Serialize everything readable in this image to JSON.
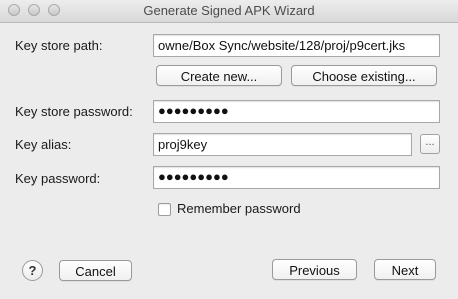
{
  "window": {
    "title": "Generate Signed APK Wizard"
  },
  "fields": {
    "key_store_path_label": "Key store path:",
    "key_store_path_value": "owne/Box Sync/website/128/proj/p9cert.jks",
    "key_store_password_label": "Key store password:",
    "key_store_password_value": "●●●●●●●●●",
    "key_alias_label": "Key alias:",
    "key_alias_value": "proj9key",
    "key_alias_browse": "...",
    "key_password_label": "Key password:",
    "key_password_value": "●●●●●●●●●"
  },
  "buttons": {
    "create_new": "Create new...",
    "choose_existing": "Choose existing...",
    "help": "?",
    "cancel": "Cancel",
    "previous": "Previous",
    "next": "Next"
  },
  "remember": {
    "label": "Remember password",
    "checked": false
  },
  "icons": {
    "close": "window-close-icon",
    "minimize": "window-minimize-icon",
    "zoom": "window-zoom-icon"
  }
}
